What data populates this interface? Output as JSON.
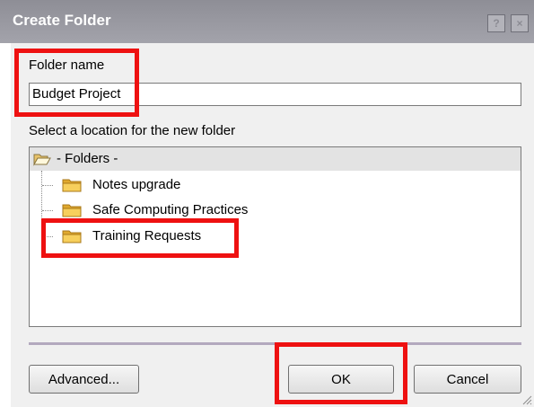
{
  "window": {
    "title": "Create Folder",
    "help_glyph": "?",
    "close_glyph": "×"
  },
  "form": {
    "name_label": "Folder name",
    "name_value": "Budget Project",
    "location_label": "Select a location for the new folder"
  },
  "tree": {
    "root_label": "- Folders -",
    "items": [
      {
        "label": "Notes upgrade",
        "icon": "folder-icon"
      },
      {
        "label": "Safe Computing Practices",
        "icon": "folder-icon"
      },
      {
        "label": "Training Requests",
        "icon": "folder-icon"
      }
    ]
  },
  "buttons": {
    "advanced": "Advanced...",
    "ok": "OK",
    "cancel": "Cancel"
  },
  "colors": {
    "highlight": "#ee1111",
    "folder": "#f2c14e",
    "titlebar": "#9a9aa2"
  }
}
